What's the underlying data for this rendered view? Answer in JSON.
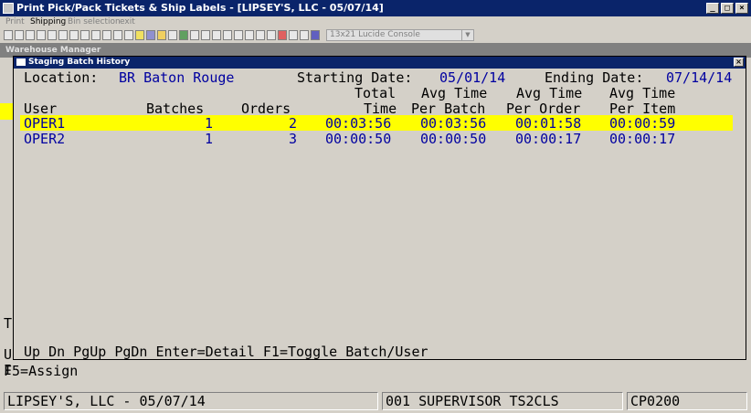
{
  "window": {
    "title": "Print Pick/Pack Tickets & Ship Labels - [LIPSEY'S, LLC - 05/07/14]",
    "btn_min": "_",
    "btn_max": "□",
    "btn_close": "×"
  },
  "menu": {
    "items": [
      "Print",
      "Shipping",
      "Bin selection",
      "exit"
    ]
  },
  "toolbar": {
    "font_select": "13x21 Lucide Console",
    "font_arrow": "▼"
  },
  "wm_title": "Warehouse Manager",
  "dialog": {
    "title": "Staging Batch History",
    "close": "×",
    "location_label": "Location:",
    "location_value": "BR Baton Rouge",
    "start_label": "Starting Date:",
    "start_value": "05/01/14",
    "end_label": "Ending Date:",
    "end_value": "07/14/14",
    "headers": {
      "total_top": "Total",
      "avgbatch_top": "Avg Time",
      "avgorder_top": "Avg Time",
      "avgitem_top": "Avg Time",
      "user": "User",
      "batches": "Batches",
      "orders": "Orders",
      "total_bot": "Time",
      "avgbatch_bot": "Per Batch",
      "avgorder_bot": "Per Order",
      "avgitem_bot": "Per Item"
    },
    "rows": [
      {
        "user": "OPER1",
        "batches": "1",
        "orders": "2",
        "total": "00:03:56",
        "per_batch": "00:03:56",
        "per_order": "00:01:58",
        "per_item": "00:00:59"
      },
      {
        "user": "OPER2",
        "batches": "1",
        "orders": "3",
        "total": "00:00:50",
        "per_batch": "00:00:50",
        "per_order": "00:00:17",
        "per_item": "00:00:17"
      }
    ],
    "keys": "Up Dn PgUp PgDn Enter=Detail F1=Toggle Batch/User"
  },
  "console": {
    "left_t": "T",
    "left_u": "U",
    "left_i": "I",
    "f5": "F5=Assign"
  },
  "status": {
    "company": "LIPSEY'S, LLC - 05/07/14",
    "user": "001 SUPERVISOR TS2CLS",
    "code": "CP0200"
  }
}
